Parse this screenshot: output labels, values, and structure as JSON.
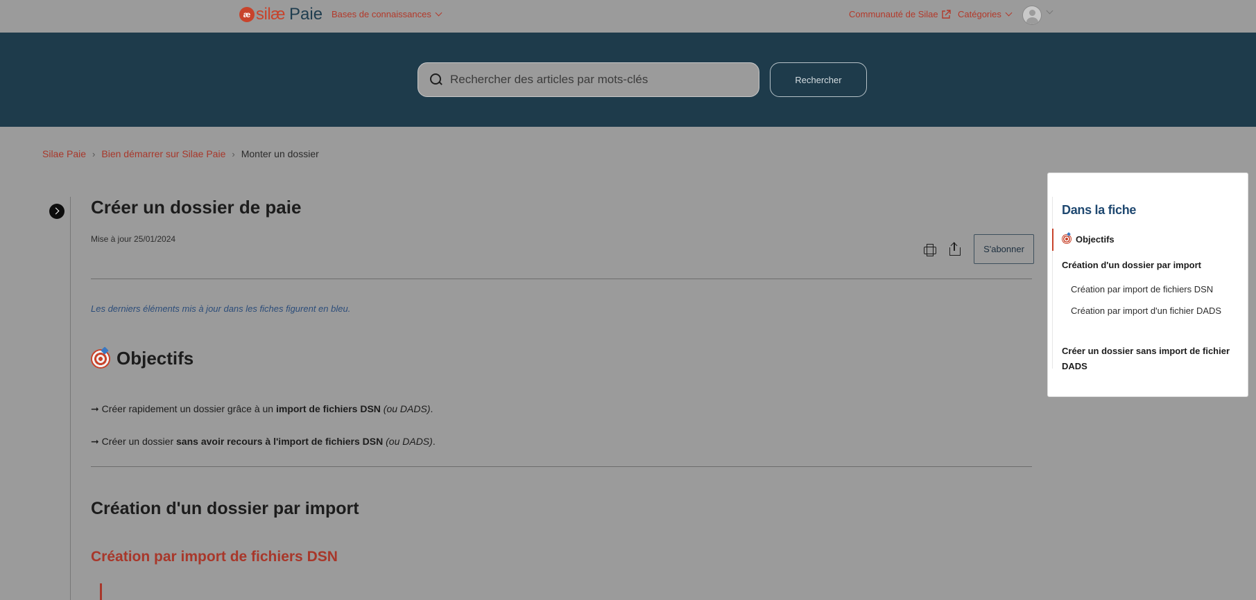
{
  "header": {
    "logo_mark": "æ",
    "logo_silae": "silæ",
    "logo_paie": "Paie",
    "kb_label": "Bases de connaissances",
    "community_label": "Communauté de Silae",
    "categories_label": "Catégories"
  },
  "hero": {
    "search_placeholder": "Rechercher des articles par mots-clés",
    "search_button": "Rechercher"
  },
  "breadcrumb": {
    "items": [
      "Silae Paie",
      "Bien démarrer sur Silae Paie"
    ],
    "current": "Monter un dossier",
    "separator": "›"
  },
  "article": {
    "title": "Créer un dossier de paie",
    "updated": "Mise à jour 25/01/2024",
    "subscribe": "S'abonner",
    "note": "Les derniers éléments mis à jour dans les fiches figurent en bleu.",
    "objectifs_title": "Objectifs",
    "bullet1": {
      "arrow": "➞",
      "text1": " Créer rapidement un dossier grâce à un ",
      "bold": "import de fichiers DSN",
      "italic": " (ou DADS)",
      "end": "."
    },
    "bullet2": {
      "arrow": "➞",
      "text1": " Créer un dossier ",
      "bold": "sans avoir recours à l'import de fichiers DSN",
      "italic": " (ou DADS)",
      "end": "."
    },
    "section_title": "Création d'un dossier par import",
    "subsection_title": "Création par import de fichiers DSN"
  },
  "toc": {
    "title": "Dans la fiche",
    "items": [
      "Objectifs",
      "Création d'un dossier par import",
      "Création par import de fichiers DSN",
      "Création par import d'un fichier DADS",
      "Créer un dossier sans import de fichier DADS"
    ]
  },
  "colors": {
    "brand_red": "#c8432b",
    "hero_bg": "#1e3b4b",
    "overlay_bg": "#9b9b9b",
    "toc_title": "#1f4870"
  }
}
